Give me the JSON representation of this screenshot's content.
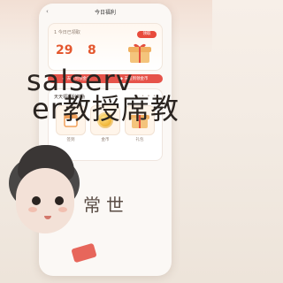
{
  "app": {
    "header_title": "今日福利"
  },
  "reward": {
    "label": "1 今日已领取",
    "amount_left": "29",
    "amount_right": "8",
    "pill": "领取",
    "bar1": "◆ 去签到领金币",
    "bar2": "◆ 去签到领金币"
  },
  "sections": {
    "daily_title": "天天领福利奖励",
    "daily_dots": "• • • •",
    "tile1_label": "签到",
    "tile2_label": "金币",
    "tile3_label": "礼包"
  },
  "overlay": {
    "line1": "salserv",
    "line2": "er教授席教",
    "bottom": "常世"
  },
  "colors": {
    "accent_red": "#e84a3b",
    "coin_gold": "#f1b83b",
    "bg": "#f3ebe3"
  },
  "icons": {
    "back": "‹",
    "coin": "gold-coin-icon",
    "gift": "gift-icon"
  }
}
